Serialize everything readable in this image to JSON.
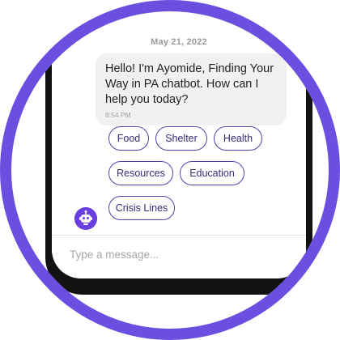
{
  "chat": {
    "date": "May 21, 2022",
    "message": {
      "text": "Hello! I'm Ayomide,  Finding Your Way in PA chatbot. How can I help you today?",
      "time": "8:54 PM"
    },
    "quick_replies": [
      "Food",
      "Shelter",
      "Health",
      "Resources",
      "Education",
      "Crisis Lines"
    ]
  },
  "composer": {
    "placeholder": "Type a message..."
  },
  "colors": {
    "accent": "#6a4fe0",
    "chip_border": "#5b3fa8",
    "bubble": "#f1f1f1"
  },
  "icons": {
    "bot": "robot-icon"
  }
}
